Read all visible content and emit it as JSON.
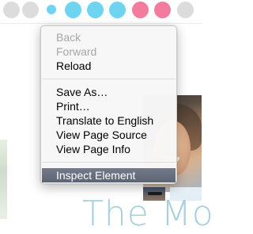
{
  "context_menu": {
    "groups": [
      [
        {
          "label": "Back",
          "enabled": false
        },
        {
          "label": "Forward",
          "enabled": false
        },
        {
          "label": "Reload",
          "enabled": true
        }
      ],
      [
        {
          "label": "Save As…",
          "enabled": true
        },
        {
          "label": "Print…",
          "enabled": true
        },
        {
          "label": "Translate to English",
          "enabled": true
        },
        {
          "label": "View Page Source",
          "enabled": true
        },
        {
          "label": "View Page Info",
          "enabled": true
        }
      ],
      [
        {
          "label": "Inspect Element",
          "enabled": true,
          "highlighted": true
        }
      ]
    ]
  },
  "background_page": {
    "hero_text": "The Mo",
    "dot_colors": [
      "#dcdcdc",
      "#dcdcdc",
      "#6fd4f1",
      "#6fd4f1",
      "#6fd4f1",
      "#6fd4f1",
      "#f37b9d",
      "#f37b9d",
      "#dcdcdc"
    ]
  },
  "colors": {
    "menu_highlight": "#5f6877",
    "disabled_text": "#a6a6a6"
  }
}
